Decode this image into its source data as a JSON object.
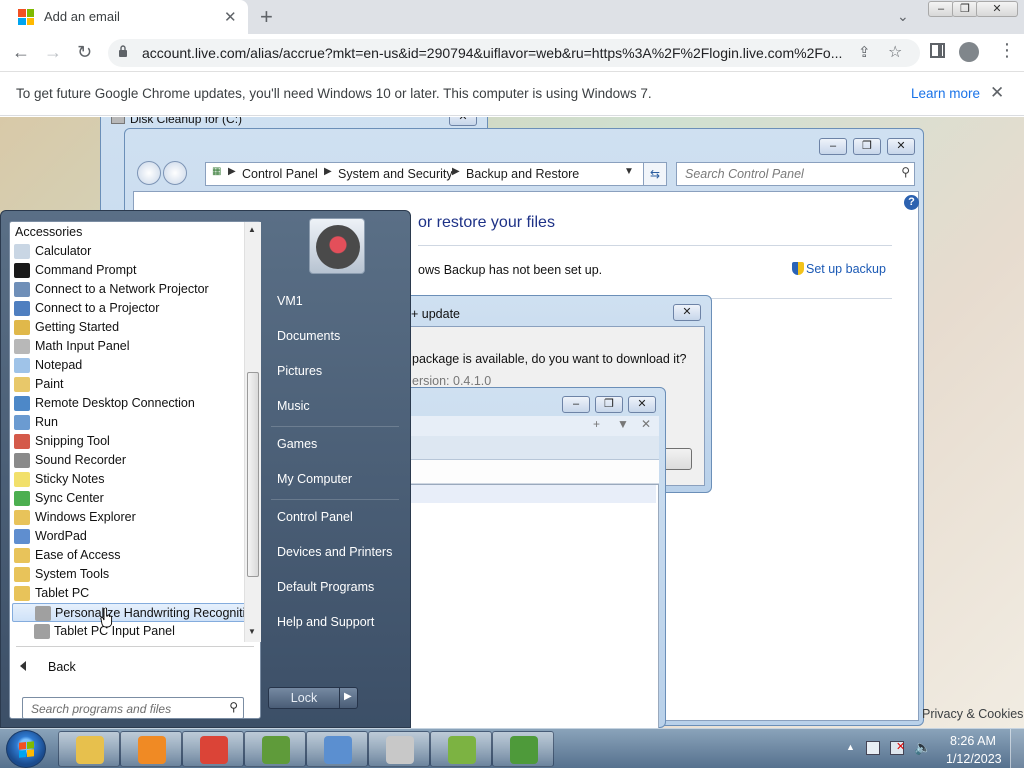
{
  "browser": {
    "tab_title": "Add an email",
    "url": "account.live.com/alias/accrue?mkt=en-us&id=290794&uiflavor=web&ru=https%3A%2F%2Flogin.live.com%2Fo...",
    "infobar_message": "To get future Google Chrome updates, you'll need Windows 10 or later. This computer is using Windows 7.",
    "infobar_link": "Learn more",
    "footer_link": "Privacy & Cookies"
  },
  "disk_cleanup": {
    "title": "Disk Cleanup for  (C:)"
  },
  "control_panel": {
    "breadcrumb": [
      "Control Panel",
      "System and Security",
      "Backup and Restore"
    ],
    "search_placeholder": "Search Control Panel",
    "heading": "or restore your files",
    "status": "ows Backup has not been set up.",
    "setup_link": "Set up backup"
  },
  "update_dialog": {
    "title": "+ update",
    "question": "package is available, do you want to download it?",
    "version": "ersion: 0.4.1.0"
  },
  "start_menu": {
    "header": "Accessories",
    "items": [
      {
        "label": "Calculator",
        "icon": "calculator-icon",
        "color": "#c9d6e4"
      },
      {
        "label": "Command Prompt",
        "icon": "cmd-icon",
        "color": "#1a1a1a"
      },
      {
        "label": "Connect to a Network Projector",
        "icon": "network-projector-icon",
        "color": "#6f8fb8"
      },
      {
        "label": "Connect to a Projector",
        "icon": "projector-icon",
        "color": "#4f7fc0"
      },
      {
        "label": "Getting Started",
        "icon": "getting-started-icon",
        "color": "#e0b84a"
      },
      {
        "label": "Math Input Panel",
        "icon": "math-input-icon",
        "color": "#b8b8b8"
      },
      {
        "label": "Notepad",
        "icon": "notepad-icon",
        "color": "#9fc3e8"
      },
      {
        "label": "Paint",
        "icon": "paint-icon",
        "color": "#e8c86a"
      },
      {
        "label": "Remote Desktop Connection",
        "icon": "remote-desktop-icon",
        "color": "#4d88c8"
      },
      {
        "label": "Run",
        "icon": "run-icon",
        "color": "#6b9bd1"
      },
      {
        "label": "Snipping Tool",
        "icon": "snipping-tool-icon",
        "color": "#d45a4a"
      },
      {
        "label": "Sound Recorder",
        "icon": "sound-recorder-icon",
        "color": "#8a8a8a"
      },
      {
        "label": "Sticky Notes",
        "icon": "sticky-notes-icon",
        "color": "#f2e06b"
      },
      {
        "label": "Sync Center",
        "icon": "sync-center-icon",
        "color": "#4caf50"
      },
      {
        "label": "Windows Explorer",
        "icon": "folder-icon",
        "color": "#e8c35a"
      },
      {
        "label": "WordPad",
        "icon": "wordpad-icon",
        "color": "#5f8ecf"
      },
      {
        "label": "Ease of Access",
        "icon": "folder-icon",
        "color": "#e8c35a"
      },
      {
        "label": "System Tools",
        "icon": "folder-icon",
        "color": "#e8c35a"
      },
      {
        "label": "Tablet PC",
        "icon": "folder-icon",
        "color": "#e8c35a"
      },
      {
        "label": "Personalize Handwriting Recognition",
        "icon": "handwriting-icon",
        "color": "#a0a0a0",
        "sub": true,
        "highlighted": true
      },
      {
        "label": "Tablet PC Input Panel",
        "icon": "tablet-input-icon",
        "color": "#a0a0a0",
        "sub": true
      }
    ],
    "back_label": "Back",
    "search_placeholder": "Search programs and files",
    "right_items": [
      "VM1",
      "Documents",
      "Pictures",
      "Music",
      "Games",
      "My Computer",
      "Control Panel",
      "Devices and Printers",
      "Default Programs",
      "Help and Support"
    ],
    "lock_label": "Lock"
  },
  "taskbar": {
    "buttons": [
      {
        "name": "explorer",
        "icon": "folder-icon",
        "color": "#e7c04d"
      },
      {
        "name": "media-player",
        "icon": "media-player-icon",
        "color": "#f08a24"
      },
      {
        "name": "chrome",
        "icon": "chrome-icon",
        "color": "#db4437"
      },
      {
        "name": "minecraft",
        "icon": "minecraft-icon",
        "color": "#5f9b3a"
      },
      {
        "name": "control-panel",
        "icon": "control-panel-icon",
        "color": "#5b8fd0"
      },
      {
        "name": "disk-cleanup",
        "icon": "disk-cleanup-icon",
        "color": "#c8c8c8"
      },
      {
        "name": "notepad-plus",
        "icon": "chart-app-icon",
        "color": "#7cb342"
      },
      {
        "name": "app-frog",
        "icon": "frog-app-icon",
        "color": "#4e9a3a"
      }
    ],
    "time": "8:26 AM",
    "date": "1/12/2023"
  }
}
